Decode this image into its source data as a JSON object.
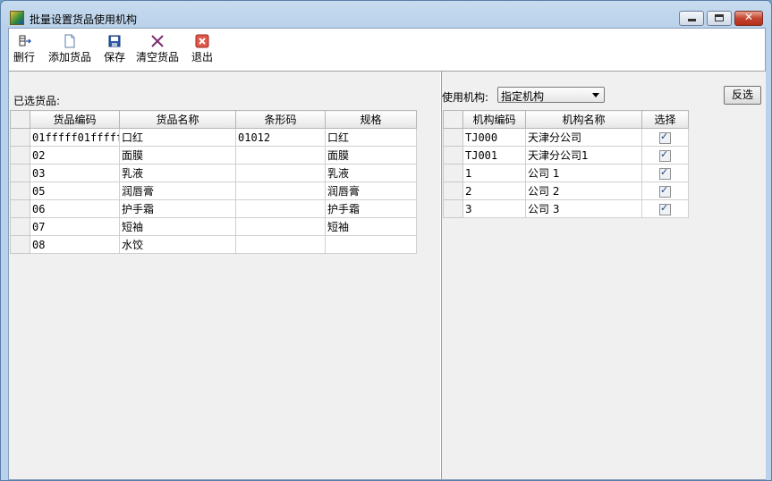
{
  "window": {
    "title": "批量设置货品使用机构"
  },
  "toolbar": {
    "delete_row": "删行",
    "add_goods": "添加货品",
    "save": "保存",
    "clear_goods": "清空货品",
    "exit": "退出"
  },
  "left": {
    "label": "已选货品:",
    "columns": [
      "货品编码",
      "货品名称",
      "条形码",
      "规格"
    ],
    "rows": [
      [
        "01fffff01fffff",
        "口红",
        "01012",
        "口红"
      ],
      [
        "02",
        "面膜",
        "",
        "面膜"
      ],
      [
        "03",
        "乳液",
        "",
        "乳液"
      ],
      [
        "05",
        "润唇膏",
        "",
        "润唇膏"
      ],
      [
        "06",
        "护手霜",
        "",
        "护手霜"
      ],
      [
        "07",
        "短袖",
        "",
        "短袖"
      ],
      [
        "08",
        "水饺",
        "",
        ""
      ]
    ]
  },
  "right": {
    "label": "使用机构:",
    "select_value": "指定机构",
    "invert_button": "反选",
    "columns": [
      "机构编码",
      "机构名称",
      "选择"
    ],
    "rows": [
      [
        "TJ000",
        "天津分公司"
      ],
      [
        "TJ001",
        "天津分公司1"
      ],
      [
        "1",
        "公司 1"
      ],
      [
        "2",
        "公司 2"
      ],
      [
        "3",
        "公司 3"
      ]
    ]
  },
  "colors": {
    "titlebar": "#b9d1ea",
    "close_button": "#c3452f",
    "panel": "#f0f0f0"
  }
}
